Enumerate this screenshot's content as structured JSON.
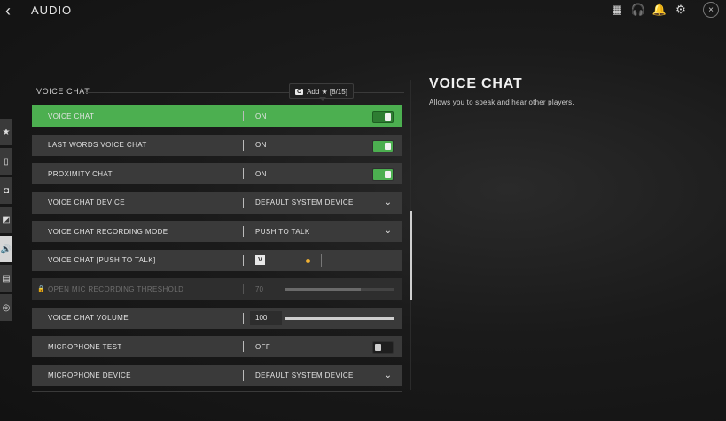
{
  "header": {
    "back_icon": "chevron-left-icon",
    "title": "AUDIO"
  },
  "top_icons": [
    "grid-icon",
    "headset-icon",
    "bell-icon",
    "gear-icon"
  ],
  "close_icon": "close-icon",
  "side_tabs": [
    {
      "icon": "star-icon",
      "glyph": "★"
    },
    {
      "icon": "mouse-icon",
      "glyph": "▯"
    },
    {
      "icon": "controller-icon",
      "glyph": "◘"
    },
    {
      "icon": "display-icon",
      "glyph": "◩"
    },
    {
      "icon": "speaker-icon",
      "glyph": "🔊",
      "active": true
    },
    {
      "icon": "interface-icon",
      "glyph": "▤"
    },
    {
      "icon": "network-icon",
      "glyph": "◎"
    }
  ],
  "section": {
    "label": "VOICE CHAT"
  },
  "badge": {
    "key": "C",
    "text": "Add ★ [8/15]"
  },
  "settings": [
    {
      "label": "VOICE CHAT",
      "value": "ON",
      "control": "toggle",
      "on": true,
      "active": true
    },
    {
      "label": "LAST WORDS VOICE CHAT",
      "value": "ON",
      "control": "toggle",
      "on": true
    },
    {
      "label": "PROXIMITY CHAT",
      "value": "ON",
      "control": "toggle",
      "on": true
    },
    {
      "label": "VOICE CHAT DEVICE",
      "value": "DEFAULT SYSTEM DEVICE",
      "control": "dropdown"
    },
    {
      "label": "VOICE CHAT RECORDING MODE",
      "value": "PUSH TO TALK",
      "control": "dropdown"
    },
    {
      "label": "VOICE CHAT [PUSH TO TALK]",
      "key": "V",
      "control": "keybind"
    },
    {
      "label": "OPEN MIC RECORDING THRESHOLD",
      "value": "70",
      "control": "slider",
      "level": 0.7,
      "disabled": true
    },
    {
      "label": "VOICE CHAT VOLUME",
      "value": "100",
      "control": "slider",
      "level": 1.0
    },
    {
      "label": "MICROPHONE TEST",
      "value": "OFF",
      "control": "toggle",
      "on": false
    },
    {
      "label": "MICROPHONE DEVICE",
      "value": "DEFAULT SYSTEM DEVICE",
      "control": "dropdown"
    }
  ],
  "detail": {
    "title": "VOICE CHAT",
    "description": "Allows you to speak and hear other players."
  }
}
